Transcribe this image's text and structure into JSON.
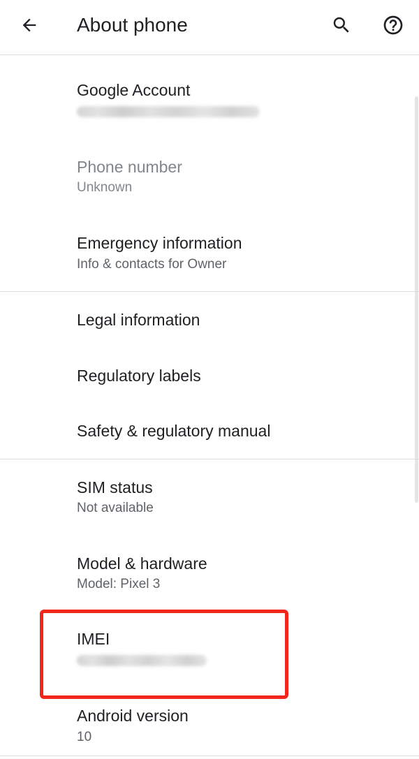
{
  "appbar": {
    "title": "About phone",
    "back_icon": "arrow-back-icon",
    "search_icon": "search-icon",
    "help_icon": "help-circle-icon"
  },
  "items": [
    {
      "title": "Google Account",
      "summary": ""
    },
    {
      "title": "Phone number",
      "summary": "Unknown"
    },
    {
      "title": "Emergency information",
      "summary": "Info & contacts for Owner"
    },
    {
      "title": "Legal information"
    },
    {
      "title": "Regulatory labels"
    },
    {
      "title": "Safety & regulatory manual"
    },
    {
      "title": "SIM status",
      "summary": "Not available"
    },
    {
      "title": "Model & hardware",
      "summary": "Model: Pixel 3"
    },
    {
      "title": "IMEI",
      "summary": ""
    },
    {
      "title": "Android version",
      "summary": "10"
    }
  ],
  "colors": {
    "text_primary": "#202124",
    "text_secondary": "#5f6368",
    "text_disabled": "#80868b",
    "divider": "#dadce0",
    "highlight": "#f2261b"
  }
}
